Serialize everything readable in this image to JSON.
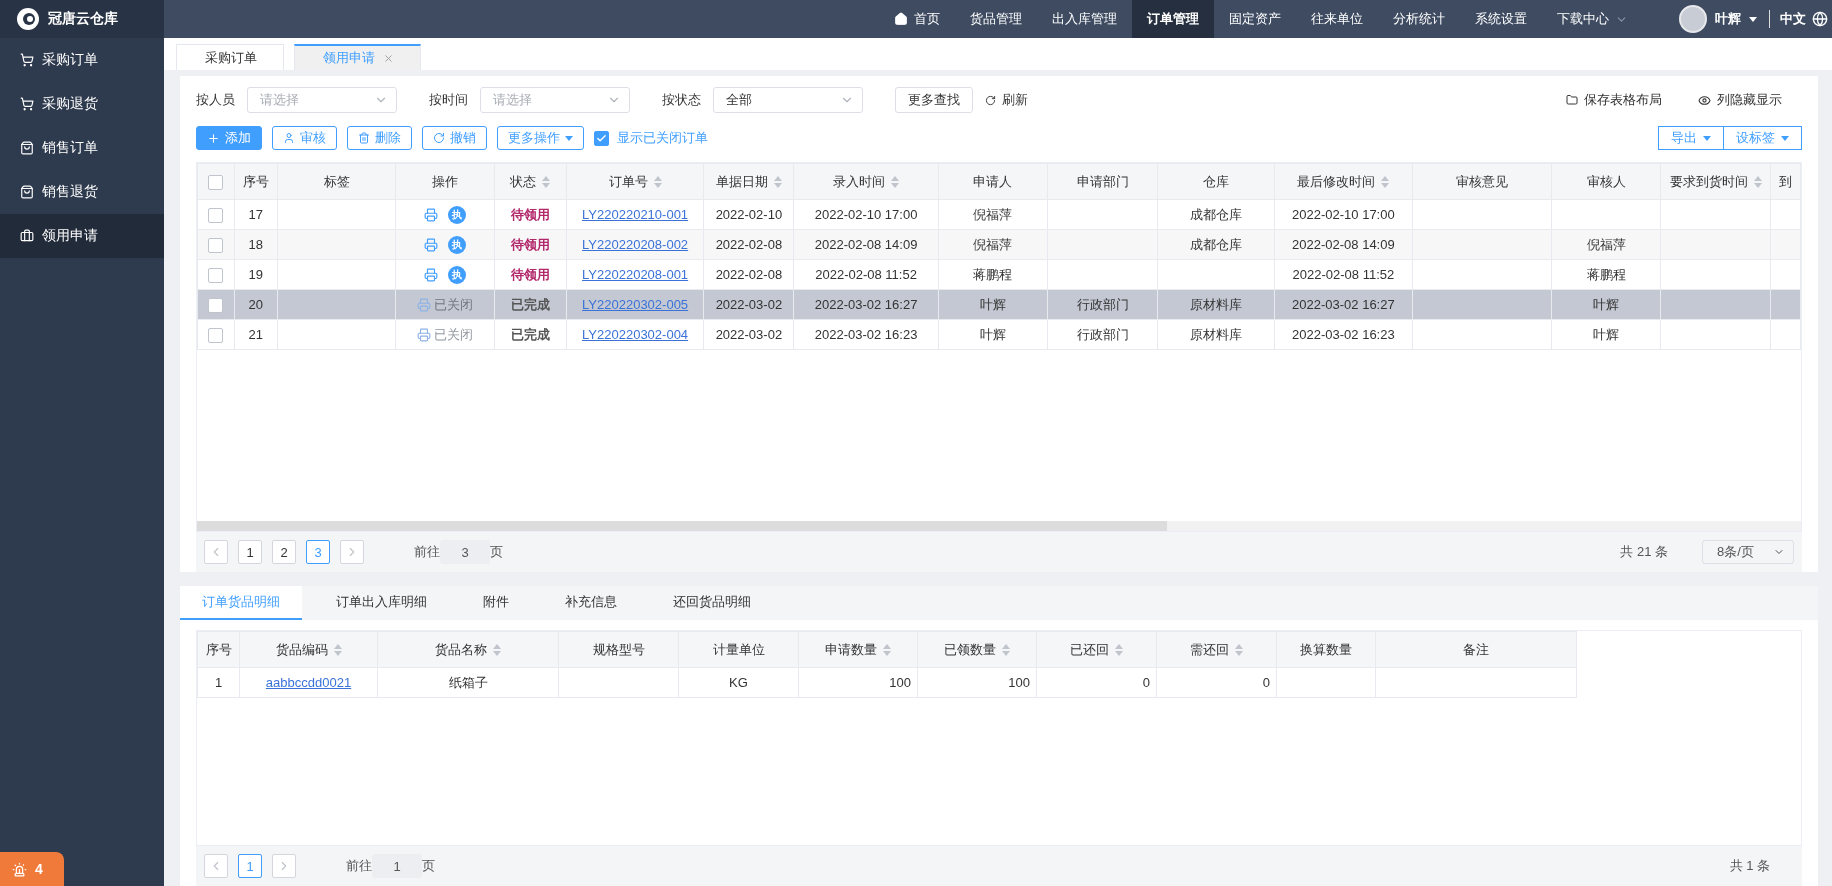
{
  "brand": {
    "name": "冠唐云仓库"
  },
  "top_nav": [
    {
      "label": "首页",
      "selected": false,
      "kind": "home"
    },
    {
      "label": "货品管理",
      "selected": false
    },
    {
      "label": "出入库管理",
      "selected": false
    },
    {
      "label": "订单管理",
      "selected": true
    },
    {
      "label": "固定资产",
      "selected": false
    },
    {
      "label": "往来单位",
      "selected": false
    },
    {
      "label": "分析统计",
      "selected": false
    },
    {
      "label": "系统设置",
      "selected": false
    },
    {
      "label": "下载中心",
      "selected": false,
      "kind": "dropdown"
    }
  ],
  "user": {
    "name": "叶辉",
    "language": "中文"
  },
  "sidebar": {
    "items": [
      {
        "label": "采购订单",
        "selected": false,
        "kind": "cart"
      },
      {
        "label": "采购退货",
        "selected": false,
        "kind": "cart"
      },
      {
        "label": "销售订单",
        "selected": false,
        "kind": "bag"
      },
      {
        "label": "销售退货",
        "selected": false,
        "kind": "bag"
      },
      {
        "label": "领用申请",
        "selected": true,
        "kind": "case"
      }
    ]
  },
  "page_tabs": [
    {
      "label": "采购订单",
      "selected": false,
      "closable": false
    },
    {
      "label": "领用申请",
      "selected": true,
      "closable": true
    }
  ],
  "filters": [
    {
      "label": "按人员",
      "placeholder": "请选择"
    },
    {
      "label": "按时间",
      "placeholder": "请选择"
    },
    {
      "label": "按状态",
      "value": "全部"
    }
  ],
  "more_search": "更多查找",
  "refresh": "刷新",
  "save_layout": "保存表格布局",
  "toggle_columns": "列隐藏显示",
  "actions": [
    {
      "label": "添加",
      "kind": "primary"
    },
    {
      "label": "审核",
      "kind": "user"
    },
    {
      "label": "删除",
      "kind": "trash"
    },
    {
      "label": "撤销",
      "kind": "undo"
    },
    {
      "label": "更多操作",
      "kind": "menu"
    }
  ],
  "show_closed": {
    "label": "显示已关闭订单",
    "checked": true
  },
  "right_actions": [
    "导出",
    "设标签"
  ],
  "orders_table": {
    "all_checked": false,
    "columns": [
      {
        "label": "序号",
        "sortable": false,
        "kind": "text"
      },
      {
        "label": "标签",
        "sortable": false,
        "kind": "text"
      },
      {
        "label": "操作",
        "sortable": false,
        "kind": "ops"
      },
      {
        "label": "状态",
        "sortable": true,
        "kind": "status"
      },
      {
        "label": "订单号",
        "sortable": true,
        "kind": "link"
      },
      {
        "label": "单据日期",
        "sortable": true,
        "kind": "text"
      },
      {
        "label": "录入时间",
        "sortable": true,
        "kind": "text"
      },
      {
        "label": "申请人",
        "sortable": false,
        "kind": "text"
      },
      {
        "label": "申请部门",
        "sortable": false,
        "kind": "text"
      },
      {
        "label": "仓库",
        "sortable": false,
        "kind": "text"
      },
      {
        "label": "最后修改时间",
        "sortable": true,
        "kind": "text"
      },
      {
        "label": "审核意见",
        "sortable": false,
        "kind": "text"
      },
      {
        "label": "审核人",
        "sortable": false,
        "kind": "text"
      },
      {
        "label": "要求到货时间",
        "sortable": true,
        "kind": "text"
      },
      {
        "label": "到",
        "sortable": false,
        "kind": "text"
      }
    ],
    "rows": [
      {
        "checked": false,
        "selected": false,
        "ops": {
          "kind": "open",
          "badge": "执"
        },
        "kind": "pending",
        "cells": [
          "17",
          null,
          null,
          "待领用",
          "LY220220210-001",
          "2022-02-10",
          "2022-02-10 17:00",
          "倪福萍",
          null,
          "成都仓库",
          "2022-02-10 17:00",
          null,
          null,
          null,
          null
        ]
      },
      {
        "checked": false,
        "selected": false,
        "ops": {
          "kind": "open",
          "badge": "执"
        },
        "kind": "pending",
        "cells": [
          "18",
          null,
          null,
          "待领用",
          "LY220220208-002",
          "2022-02-08",
          "2022-02-08 14:09",
          "倪福萍",
          null,
          "成都仓库",
          "2022-02-08 14:09",
          null,
          "倪福萍",
          null,
          null
        ]
      },
      {
        "checked": false,
        "selected": false,
        "ops": {
          "kind": "open",
          "badge": "执"
        },
        "kind": "pending",
        "cells": [
          "19",
          null,
          null,
          "待领用",
          "LY220220208-001",
          "2022-02-08",
          "2022-02-08 11:52",
          "蒋鹏程",
          null,
          null,
          "2022-02-08 11:52",
          null,
          "蒋鹏程",
          null,
          null
        ]
      },
      {
        "checked": false,
        "selected": true,
        "ops": {
          "kind": "closed",
          "label": "已关闭"
        },
        "kind": "done",
        "cells": [
          "20",
          null,
          null,
          "已完成",
          "LY220220302-005",
          "2022-03-02",
          "2022-03-02 16:27",
          "叶辉",
          "行政部门",
          "原材料库",
          "2022-03-02 16:27",
          null,
          "叶辉",
          null,
          null
        ]
      },
      {
        "checked": false,
        "selected": false,
        "ops": {
          "kind": "closed",
          "label": "已关闭"
        },
        "kind": "done",
        "cells": [
          "21",
          null,
          null,
          "已完成",
          "LY220220302-004",
          "2022-03-02",
          "2022-03-02 16:23",
          "叶辉",
          "行政部门",
          "原材料库",
          "2022-03-02 16:23",
          null,
          "叶辉",
          null,
          null
        ]
      }
    ]
  },
  "orders_pager": {
    "pages": [
      {
        "label": "1",
        "selected": false
      },
      {
        "label": "2",
        "selected": false
      },
      {
        "label": "3",
        "selected": true
      }
    ],
    "goto_prefix": "前往",
    "goto_value": "3",
    "goto_suffix": "页",
    "total": "共 21 条",
    "page_size": "8条/页"
  },
  "detail_tabs": [
    {
      "label": "订单货品明细",
      "selected": true
    },
    {
      "label": "订单出入库明细",
      "selected": false
    },
    {
      "label": "附件",
      "selected": false
    },
    {
      "label": "补充信息",
      "selected": false
    },
    {
      "label": "还回货品明细",
      "selected": false
    }
  ],
  "detail_table": {
    "columns": [
      {
        "label": "序号",
        "sortable": false,
        "kind": "text"
      },
      {
        "label": "货品编码",
        "sortable": true,
        "kind": "link"
      },
      {
        "label": "货品名称",
        "sortable": true,
        "kind": "text"
      },
      {
        "label": "规格型号",
        "sortable": false,
        "kind": "text"
      },
      {
        "label": "计量单位",
        "sortable": false,
        "kind": "text"
      },
      {
        "label": "申请数量",
        "sortable": true,
        "kind": "number"
      },
      {
        "label": "已领数量",
        "sortable": true,
        "kind": "number"
      },
      {
        "label": "已还回",
        "sortable": true,
        "kind": "number"
      },
      {
        "label": "需还回",
        "sortable": true,
        "kind": "number"
      },
      {
        "label": "换算数量",
        "sortable": false,
        "kind": "text"
      },
      {
        "label": "备注",
        "sortable": false,
        "kind": "text"
      }
    ],
    "rows": [
      [
        "1",
        "aabbccdd0021",
        "纸箱子",
        null,
        "KG",
        "100",
        "100",
        "0",
        "0",
        null,
        null
      ]
    ]
  },
  "detail_pager": {
    "pages": [
      {
        "label": "1",
        "selected": true
      }
    ],
    "goto_prefix": "前往",
    "goto_value": "1",
    "goto_suffix": "页",
    "total": "共 1 条"
  },
  "alert_badge": {
    "count": "4"
  }
}
